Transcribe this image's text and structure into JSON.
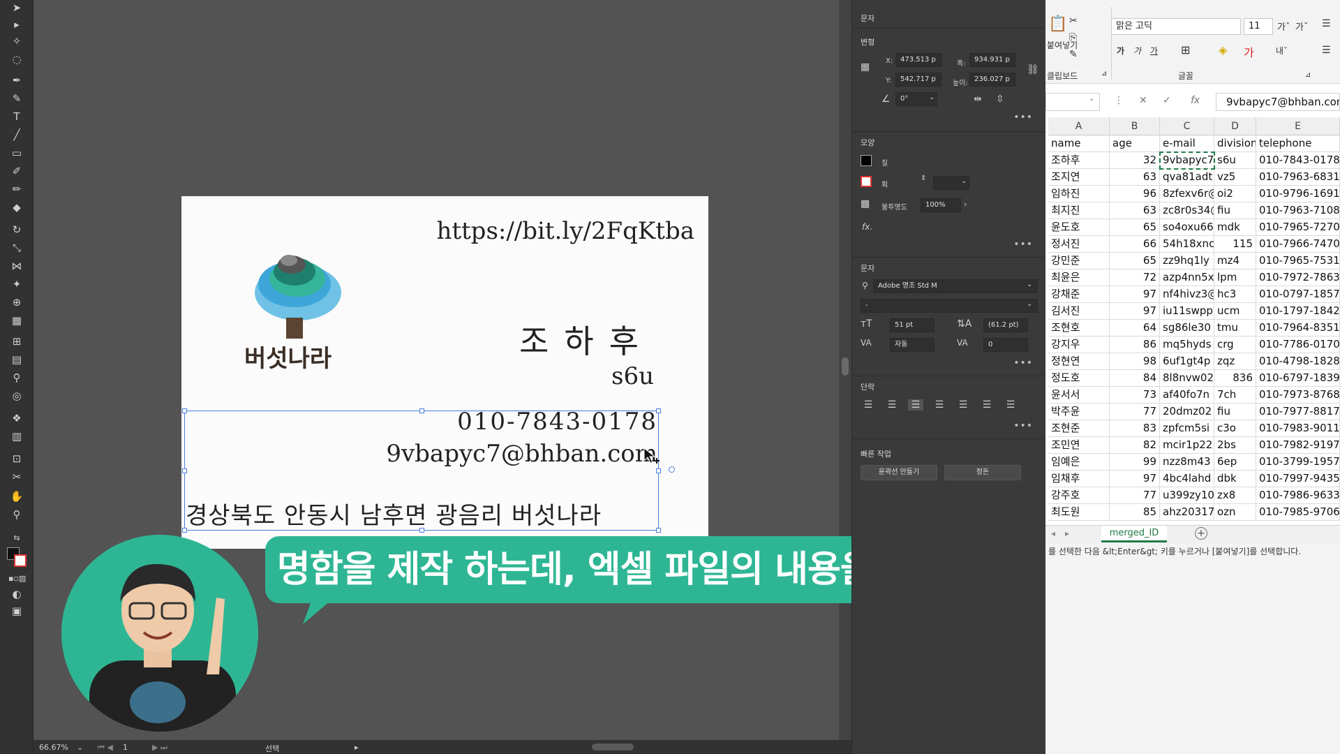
{
  "illustrator": {
    "status": {
      "zoom": "66.67%",
      "artboard": "1",
      "tool": "선택"
    },
    "card": {
      "url": "https://bit.ly/2FqKtba",
      "logo_text": "버섯나라",
      "name": "조하후",
      "division": "s6u",
      "telephone": "010-7843-0178",
      "email": "9vbapyc7@bhban.com",
      "address": "경상북도 안동시 남후면 광음리 버섯나라"
    },
    "caption": "명함을 제작 하는데, 엑셀 파일의 내용을 하나하나",
    "colors": {
      "accent": "#2eb694",
      "selection": "#4a7be0"
    }
  },
  "properties": {
    "header": "문자",
    "transform": {
      "title": "변형",
      "x_label": "X:",
      "x": "473.513 p",
      "y_label": "Y:",
      "y": "542.717 p",
      "w_label": "폭:",
      "w": "934.931 p",
      "h_label": "높이:",
      "h": "236.027 p",
      "angle": "0°"
    },
    "appearance": {
      "title": "모양",
      "fill_label": "칠",
      "stroke_label": "획",
      "opacity_label": "불투명도",
      "opacity": "100%",
      "fx": "fx."
    },
    "character": {
      "title": "문자",
      "font": "Adobe 명조 Std M",
      "style": "-",
      "size": "51 pt",
      "leading": "(61.2 pt)",
      "kerning": "자동",
      "tracking": "0"
    },
    "paragraph": {
      "title": "단락"
    },
    "quick_actions": {
      "title": "빠른 작업",
      "outline_button": "윤곽선 만들기",
      "arrange_button": "정돈"
    }
  },
  "excel": {
    "ribbon": {
      "font_name": "맑은 고딕",
      "font_size": "11",
      "paste_label": "붙여넣기",
      "clipboard_label": "클립보드",
      "font_group_label": "글꼴"
    },
    "formula_bar": {
      "content": "9vbapyc7@bhban.com",
      "fx": "fx"
    },
    "columns": [
      "A",
      "B",
      "C",
      "D",
      "E"
    ],
    "headers": [
      "name",
      "age",
      "e-mail",
      "division",
      "telephone"
    ],
    "rows": [
      [
        "조하후",
        "32",
        "9vbapyc7",
        "s6u",
        "010-7843-0178"
      ],
      [
        "조지연",
        "63",
        "qva81adt",
        "vz5",
        "010-7963-6831"
      ],
      [
        "임하진",
        "96",
        "8zfexv6r@",
        "oi2",
        "010-9796-1691"
      ],
      [
        "최지진",
        "63",
        "zc8r0s34@",
        "fiu",
        "010-7963-7108"
      ],
      [
        "윤도호",
        "65",
        "so4oxu66",
        "mdk",
        "010-7965-7270"
      ],
      [
        "정서진",
        "66",
        "54h18xnc",
        "115",
        "010-7966-7470"
      ],
      [
        "강민준",
        "65",
        "zz9hq1ly",
        "mz4",
        "010-7965-7531"
      ],
      [
        "최윤은",
        "72",
        "azp4nn5x",
        "lpm",
        "010-7972-7863"
      ],
      [
        "강채준",
        "97",
        "nf4hivz3@",
        "hc3",
        "010-0797-1857"
      ],
      [
        "김서진",
        "97",
        "iu11swpp",
        "ucm",
        "010-1797-1842"
      ],
      [
        "조현호",
        "64",
        "sg86le30",
        "tmu",
        "010-7964-8351"
      ],
      [
        "강지우",
        "86",
        "mq5hyds",
        "crg",
        "010-7786-0170"
      ],
      [
        "정현연",
        "98",
        "6uf1gt4p",
        "zqz",
        "010-4798-1828"
      ],
      [
        "정도호",
        "84",
        "8l8nvw02",
        "836",
        "010-6797-1839"
      ],
      [
        "윤서서",
        "73",
        "af40fo7n",
        "7ch",
        "010-7973-8768"
      ],
      [
        "박주윤",
        "77",
        "20dmz02",
        "fiu",
        "010-7977-8817"
      ],
      [
        "조현준",
        "83",
        "zpfcm5si",
        "c3o",
        "010-7983-9011"
      ],
      [
        "조민연",
        "82",
        "mcir1p22",
        "2bs",
        "010-7982-9197"
      ],
      [
        "임예은",
        "99",
        "nzz8m43",
        "6ep",
        "010-3799-1957"
      ],
      [
        "임채후",
        "97",
        "4bc4lahd",
        "dbk",
        "010-7997-9435"
      ],
      [
        "강주호",
        "77",
        "u399zy10",
        "zx8",
        "010-7986-9633"
      ],
      [
        "최도원",
        "85",
        "ahz20317",
        "ozn",
        "010-7985-9706"
      ]
    ],
    "sheet_tab": "merged_ID",
    "status_text": "를 선택한 다음 &lt;Enter&gt; 키를 누르거나 [붙여넣기]를 선택합니다."
  }
}
